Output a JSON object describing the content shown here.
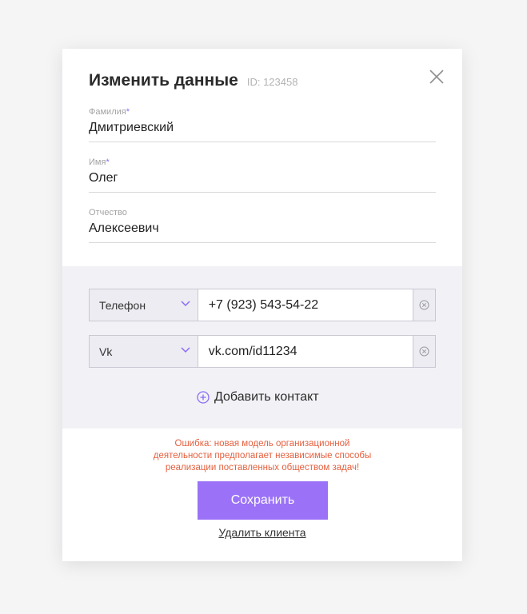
{
  "header": {
    "title": "Изменить данные",
    "id_text": "ID: 123458"
  },
  "fields": [
    {
      "label": "Фамилия",
      "required": "*",
      "value": "Дмитриевский"
    },
    {
      "label": "Имя",
      "required": "*",
      "value": "Олег"
    },
    {
      "label": "Отчество",
      "required": "",
      "value": "Алексеевич"
    }
  ],
  "contacts": [
    {
      "type": "Телефон",
      "value": "+7 (923) 543-54-22"
    },
    {
      "type": "Vk",
      "value": "vk.com/id11234"
    }
  ],
  "add_contact_label": "Добавить контакт",
  "error_lines": [
    "Ошибка: новая модель организационной",
    "деятельности предполагает независимые способы",
    "реализации поставленных обществом задач!"
  ],
  "save_label": "Сохранить",
  "delete_label": "Удалить клиента",
  "icons": {
    "close": "close-icon",
    "chevron": "chevron-down-icon",
    "clear": "clear-icon",
    "add": "plus-circle-icon"
  },
  "colors": {
    "accent": "#9b72f7",
    "error": "#e5603f",
    "required": "#8b6cf6",
    "contacts_bg": "#f2f2f6"
  }
}
